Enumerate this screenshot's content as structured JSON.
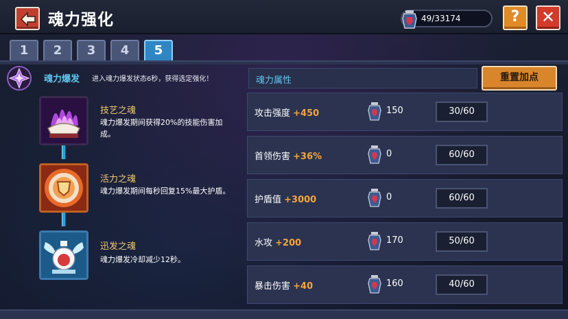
{
  "header": {
    "title": "魂力强化",
    "counter": "49/33174",
    "help_label": "?",
    "close_label": "✕"
  },
  "tabs": [
    {
      "label": "1",
      "active": false
    },
    {
      "label": "2",
      "active": false
    },
    {
      "label": "3",
      "active": false
    },
    {
      "label": "4",
      "active": false
    },
    {
      "label": "5",
      "active": true
    }
  ],
  "burst": {
    "title": "魂力爆发",
    "description": "进入魂力爆发状态6秒，获得选定强化！"
  },
  "skills": [
    {
      "icon": "purple-flame-shell-icon",
      "name": "技艺之魂",
      "description": "魂力爆发期间获得20%的技能伤害加成。"
    },
    {
      "icon": "orange-shield-icon",
      "name": "活力之魂",
      "description": "魂力爆发期间每秒回复15%最大护盾。"
    },
    {
      "icon": "winged-potion-icon",
      "name": "迅发之魂",
      "description": "魂力爆发冷却减少12秒。"
    }
  ],
  "attributes": {
    "header_label": "魂力属性",
    "reset_label": "重置加点",
    "rows": [
      {
        "name": "攻击强度",
        "bonus": "+450",
        "cost": "150",
        "level": "30/60"
      },
      {
        "name": "首领伤害",
        "bonus": "+36%",
        "cost": "0",
        "level": "60/60"
      },
      {
        "name": "护盾值",
        "bonus": "+3000",
        "cost": "0",
        "level": "60/60"
      },
      {
        "name": "水攻",
        "bonus": "+200",
        "cost": "170",
        "level": "50/60"
      },
      {
        "name": "暴击伤害",
        "bonus": "+40",
        "cost": "160",
        "level": "40/60"
      }
    ]
  },
  "colors": {
    "accent_blue": "#5fc6ef",
    "bonus_orange": "#f6a53a",
    "skill_name_gold": "#f0c874",
    "back_button_red": "#c04030",
    "help_button_orange": "#e08a28"
  }
}
